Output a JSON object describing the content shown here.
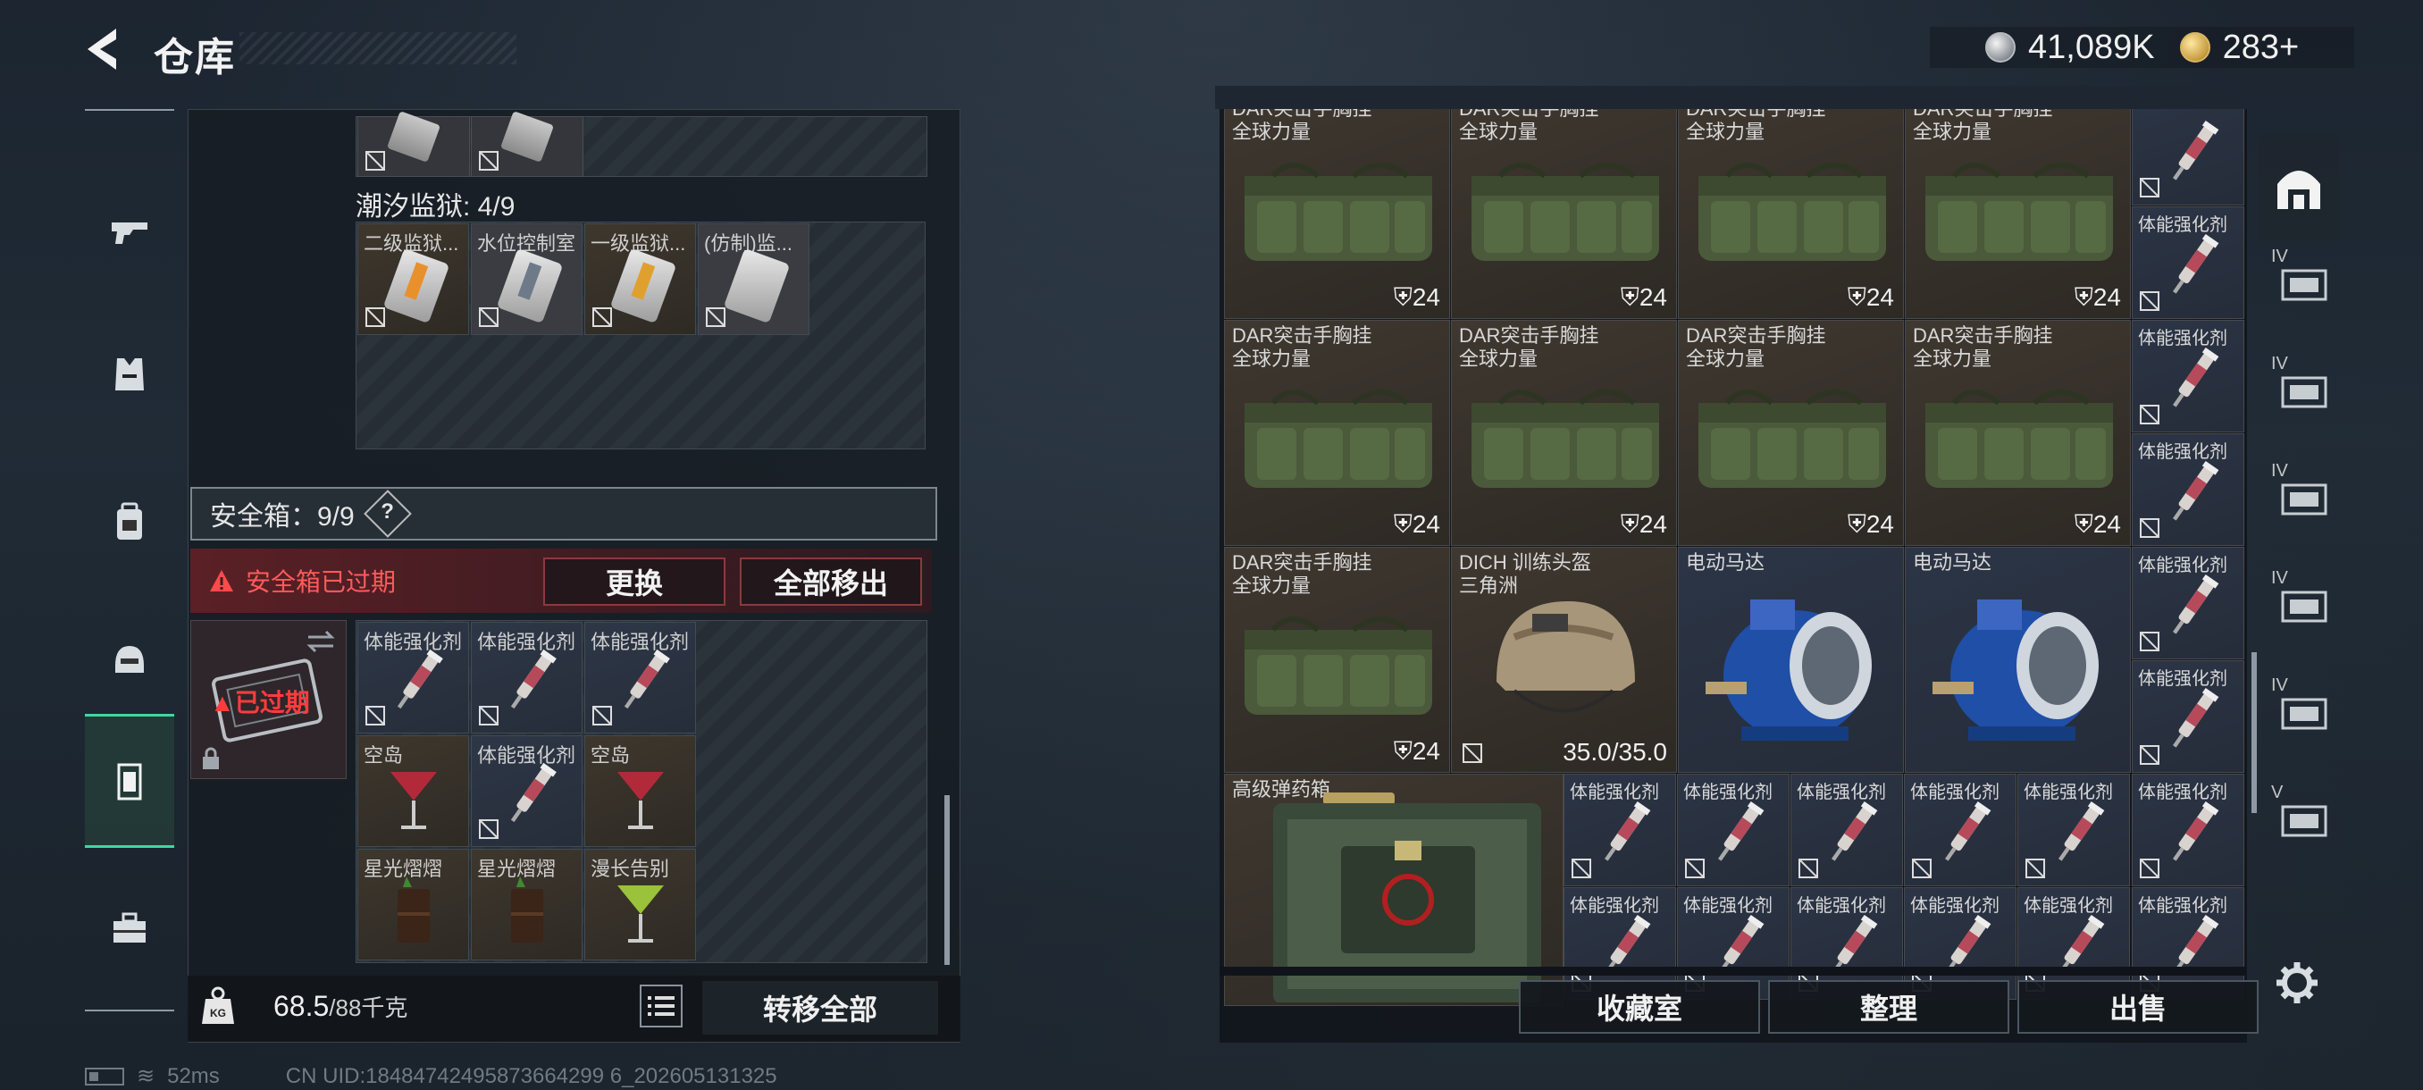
{
  "header": {
    "title": "仓库"
  },
  "currency": {
    "silver": "41,089K",
    "gold": "283+"
  },
  "left_nav": {
    "items": [
      {
        "name": "weapon"
      },
      {
        "name": "armor"
      },
      {
        "name": "backpack"
      },
      {
        "name": "helmet"
      },
      {
        "name": "safebox",
        "active": true
      },
      {
        "name": "toolbox"
      }
    ]
  },
  "left_panel": {
    "tide_prison_label": "潮汐监狱: 4/9",
    "keys": [
      {
        "label": "二级监狱..."
      },
      {
        "label": "水位控制室"
      },
      {
        "label": "一级监狱..."
      },
      {
        "label": "(仿制)监..."
      }
    ],
    "safebox_label": "安全箱：9/9",
    "help_label": "?",
    "warning_text": "安全箱已过期",
    "replace_button": "更换",
    "move_all_out_button": "全部移出",
    "expired_tag": "已过期",
    "safebox_items": [
      {
        "label": "体能强化剂",
        "type": "injector"
      },
      {
        "label": "体能强化剂",
        "type": "injector"
      },
      {
        "label": "体能强化剂",
        "type": "injector"
      },
      {
        "label": "空岛",
        "type": "cocktail-red"
      },
      {
        "label": "体能强化剂",
        "type": "injector"
      },
      {
        "label": "空岛",
        "type": "cocktail-red"
      },
      {
        "label": "星光熠熠",
        "type": "drink-dark"
      },
      {
        "label": "星光熠熠",
        "type": "drink-dark"
      },
      {
        "label": "漫长告别",
        "type": "cocktail-green"
      }
    ],
    "weight_value": "68.5",
    "weight_capacity": "/88千克",
    "transfer_all_button": "转移全部"
  },
  "status": {
    "ping": "52ms",
    "uid": "CN UID:18484742495873664299 6_202605131325"
  },
  "right_panel": {
    "rows": [
      {
        "items": [
          {
            "label1": "DAR突击手胸挂",
            "label2": "全球力量",
            "count": "24"
          },
          {
            "label1": "DAR突击手胸挂",
            "label2": "全球力量",
            "count": "24"
          },
          {
            "label1": "DAR突击手胸挂",
            "label2": "全球力量",
            "count": "24"
          },
          {
            "label1": "DAR突击手胸挂",
            "label2": "全球力量",
            "count": "24"
          }
        ]
      },
      {
        "items": [
          {
            "label1": "DAR突击手胸挂",
            "label2": "全球力量",
            "count": "24"
          },
          {
            "label1": "DAR突击手胸挂",
            "label2": "全球力量",
            "count": "24"
          },
          {
            "label1": "DAR突击手胸挂",
            "label2": "全球力量",
            "count": "24"
          },
          {
            "label1": "DAR突击手胸挂",
            "label2": "全球力量",
            "count": "24"
          }
        ]
      }
    ],
    "row3": [
      {
        "label1": "DAR突击手胸挂",
        "label2": "全球力量",
        "count": "24",
        "kind": "vest"
      },
      {
        "label1": "DICH 训练头盔",
        "label2": "三角洲",
        "count": "35.0/35.0",
        "kind": "helmet"
      },
      {
        "label1": "电动马达",
        "label2": "",
        "count": "",
        "kind": "motor"
      },
      {
        "label1": "电动马达",
        "label2": "",
        "count": "",
        "kind": "motor"
      }
    ],
    "ammo_box_label": "高级弹药箱",
    "injector_label": "体能强化剂",
    "collection_button": "收藏室",
    "sort_button": "整理",
    "sell_button": "出售"
  },
  "right_tabs": [
    {
      "label": "",
      "name": "main-stash"
    },
    {
      "label": "IV",
      "name": "stash-iv-1"
    },
    {
      "label": "IV",
      "name": "stash-iv-2"
    },
    {
      "label": "IV",
      "name": "stash-iv-3"
    },
    {
      "label": "IV",
      "name": "stash-iv-add"
    },
    {
      "label": "IV",
      "name": "stash-iv-folder"
    },
    {
      "label": "V",
      "name": "stash-v"
    }
  ]
}
